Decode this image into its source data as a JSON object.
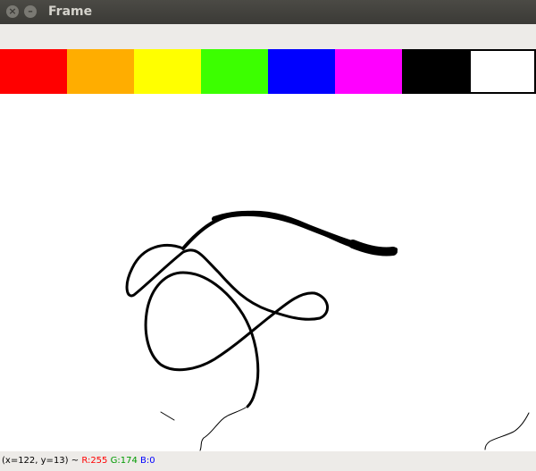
{
  "window": {
    "title": "Frame",
    "close_icon": "close-icon",
    "minimize_icon": "minimize-icon"
  },
  "palette": {
    "swatches": [
      {
        "name": "red",
        "color": "#ff0000"
      },
      {
        "name": "orange",
        "color": "#ffad00"
      },
      {
        "name": "yellow",
        "color": "#ffff00"
      },
      {
        "name": "green",
        "color": "#3cff00"
      },
      {
        "name": "blue",
        "color": "#0000ff"
      },
      {
        "name": "magenta",
        "color": "#ff00ff"
      },
      {
        "name": "black",
        "color": "#000000"
      },
      {
        "name": "white",
        "color": "#ffffff"
      }
    ]
  },
  "status": {
    "coords": "(x=122, y=13) ~",
    "r": "R:255",
    "g": "G:174",
    "b": "B:0",
    "r_color": "#ff0000",
    "g_color": "#009a00",
    "b_color": "#0000ff"
  }
}
